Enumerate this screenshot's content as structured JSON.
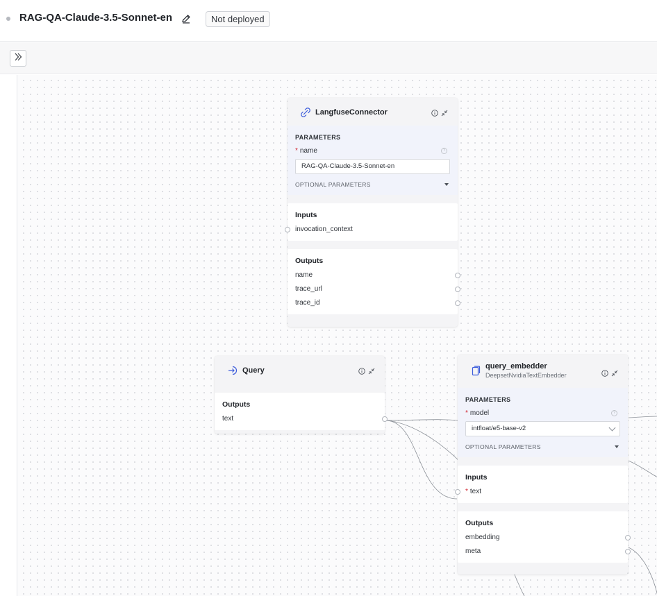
{
  "header": {
    "pipeline_title": "RAG-QA-Claude-3.5-Sonnet-en",
    "status_label": "Not deployed"
  },
  "nodes": {
    "langfuse": {
      "name": "LangfuseConnector",
      "icon": "link-icon",
      "parameters_label": "PARAMETERS",
      "param_label": "name",
      "param_value": "RAG-QA-Claude-3.5-Sonnet-en",
      "optional_label": "OPTIONAL PARAMETERS",
      "inputs_label": "Inputs",
      "inputs": [
        "invocation_context"
      ],
      "outputs_label": "Outputs",
      "outputs": [
        "name",
        "trace_url",
        "trace_id"
      ]
    },
    "query": {
      "name": "Query",
      "icon": "input-arrow-icon",
      "outputs_label": "Outputs",
      "outputs": [
        "text"
      ]
    },
    "query_embedder": {
      "name": "query_embedder",
      "subtitle": "DeepsetNvidiaTextEmbedder",
      "icon": "document-icon",
      "parameters_label": "PARAMETERS",
      "param_label": "model",
      "param_value": "intfloat/e5-base-v2",
      "optional_label": "OPTIONAL PARAMETERS",
      "inputs_label": "Inputs",
      "inputs": [
        "text"
      ],
      "outputs_label": "Outputs",
      "outputs": [
        "embedding",
        "meta"
      ]
    }
  },
  "colors": {
    "accent": "#3b5bdb",
    "required": "#d1242f",
    "params_bg": "#f1f3fb"
  }
}
